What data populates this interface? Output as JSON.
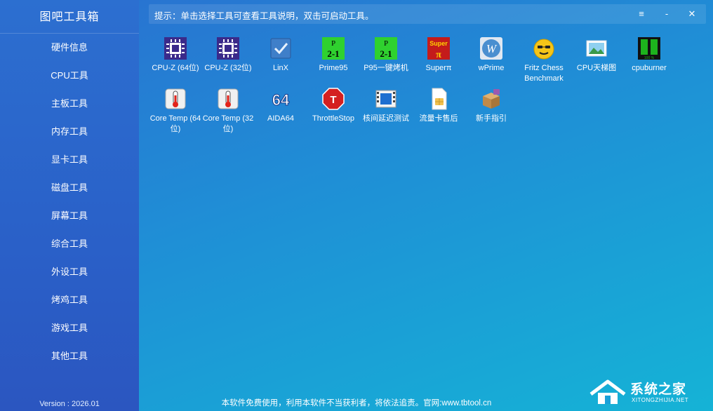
{
  "app": {
    "title": "图吧工具箱",
    "version": "Version : 2026.01"
  },
  "sidebar": {
    "items": [
      {
        "label": "硬件信息"
      },
      {
        "label": "CPU工具"
      },
      {
        "label": "主板工具"
      },
      {
        "label": "内存工具"
      },
      {
        "label": "显卡工具"
      },
      {
        "label": "磁盘工具"
      },
      {
        "label": "屏幕工具"
      },
      {
        "label": "综合工具"
      },
      {
        "label": "外设工具"
      },
      {
        "label": "烤鸡工具"
      },
      {
        "label": "游戏工具"
      },
      {
        "label": "其他工具"
      }
    ]
  },
  "topbar": {
    "hint": "提示：单击选择工具可查看工具说明，双击可启动工具。",
    "menu_icon": "≡",
    "minimize_icon": "-",
    "close_icon": "✕"
  },
  "tools": [
    {
      "label": "CPU-Z (64位)",
      "icon": "cpuz-icon"
    },
    {
      "label": "CPU-Z (32位)",
      "icon": "cpuz-icon"
    },
    {
      "label": "LinX",
      "icon": "linx-icon"
    },
    {
      "label": "Prime95",
      "icon": "prime95-icon"
    },
    {
      "label": "P95一键烤机",
      "icon": "prime95-icon"
    },
    {
      "label": "Superπ",
      "icon": "superpi-icon"
    },
    {
      "label": "wPrime",
      "icon": "wprime-icon"
    },
    {
      "label": "Fritz Chess Benchmark",
      "icon": "fritz-icon"
    },
    {
      "label": "CPU天梯图",
      "icon": "picture-icon"
    },
    {
      "label": "cpuburner",
      "icon": "cpuburner-icon"
    },
    {
      "label": "Core Temp (64位)",
      "icon": "thermometer-icon"
    },
    {
      "label": "Core Temp (32位)",
      "icon": "thermometer-icon"
    },
    {
      "label": "AIDA64",
      "icon": "aida64-icon"
    },
    {
      "label": "ThrottleStop",
      "icon": "stop-sign-icon"
    },
    {
      "label": "核间延迟测试",
      "icon": "film-icon"
    },
    {
      "label": "流量卡售后",
      "icon": "sim-card-icon"
    },
    {
      "label": "新手指引",
      "icon": "package-icon"
    }
  ],
  "icon_text": {
    "aida": "64",
    "superpi_top": "Super",
    "superpi_bottom": "π",
    "prime_top": "P",
    "prime_bottom": "2-1",
    "cpuburner_pct": "100 %"
  },
  "footer": {
    "notice": "本软件免费使用，利用本软件不当获利者，将依法追责。官网:www.tbtool.cn"
  },
  "watermark": {
    "cn": "系统之家",
    "en": "XITONGZHIJIA.NET"
  },
  "colors": {
    "accent": "#1f8fd6",
    "sidebar": "#2a60c8"
  }
}
